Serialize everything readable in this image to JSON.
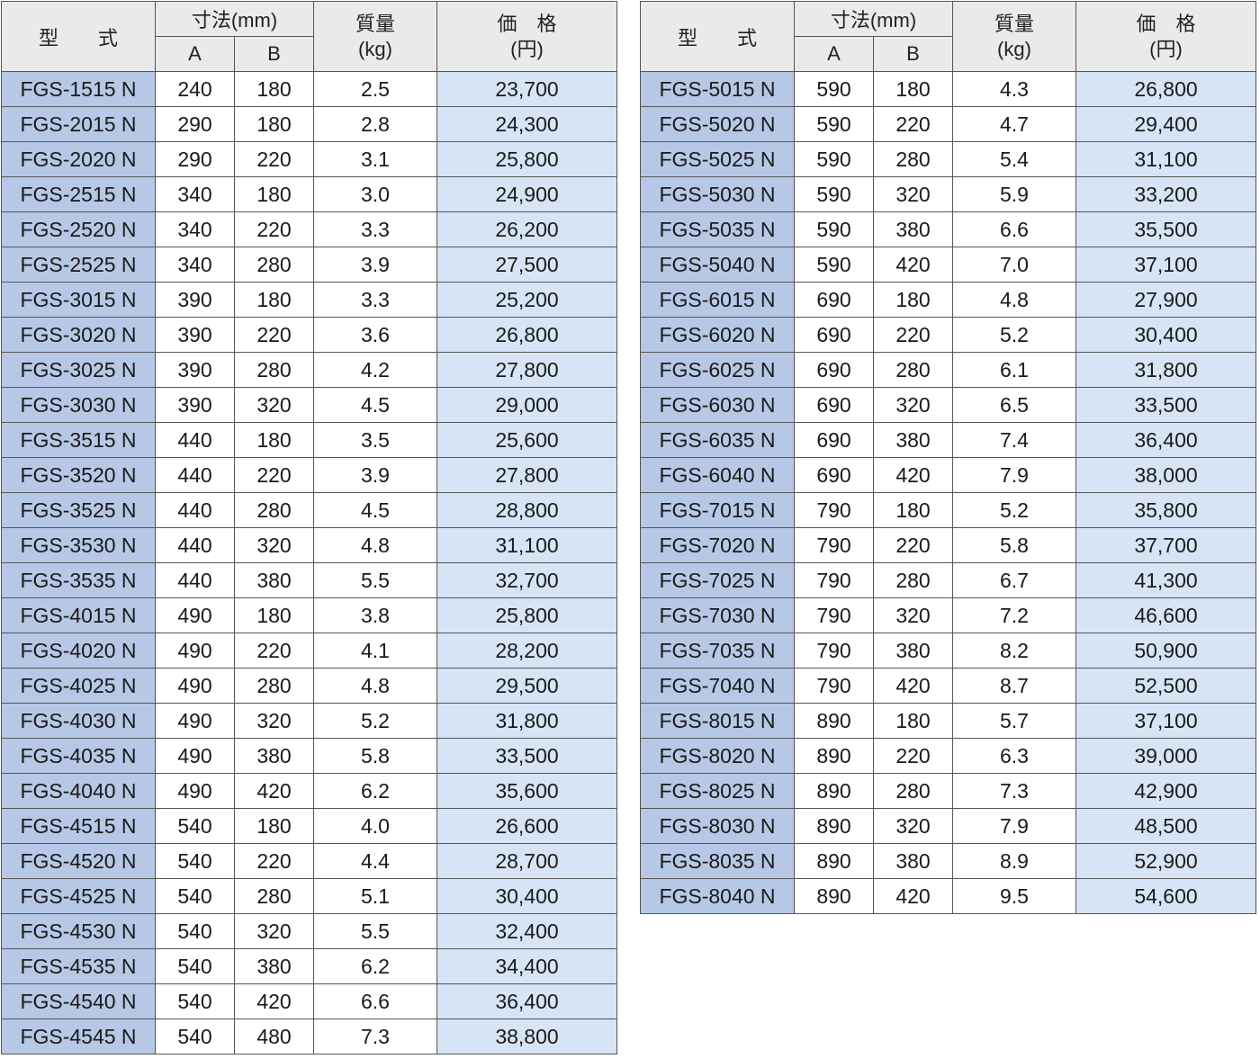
{
  "header": {
    "model": "型　　式",
    "dimensions": "寸法(mm)",
    "dim_a": "A",
    "dim_b": "B",
    "mass": "質量",
    "mass_unit": "(kg)",
    "price": "価　格",
    "price_unit": "(円)"
  },
  "left_rows": [
    {
      "model": "FGS-1515 N",
      "a": "240",
      "b": "180",
      "mass": "2.5",
      "price": "23,700"
    },
    {
      "model": "FGS-2015 N",
      "a": "290",
      "b": "180",
      "mass": "2.8",
      "price": "24,300"
    },
    {
      "model": "FGS-2020 N",
      "a": "290",
      "b": "220",
      "mass": "3.1",
      "price": "25,800"
    },
    {
      "model": "FGS-2515 N",
      "a": "340",
      "b": "180",
      "mass": "3.0",
      "price": "24,900"
    },
    {
      "model": "FGS-2520 N",
      "a": "340",
      "b": "220",
      "mass": "3.3",
      "price": "26,200"
    },
    {
      "model": "FGS-2525 N",
      "a": "340",
      "b": "280",
      "mass": "3.9",
      "price": "27,500"
    },
    {
      "model": "FGS-3015 N",
      "a": "390",
      "b": "180",
      "mass": "3.3",
      "price": "25,200"
    },
    {
      "model": "FGS-3020 N",
      "a": "390",
      "b": "220",
      "mass": "3.6",
      "price": "26,800"
    },
    {
      "model": "FGS-3025 N",
      "a": "390",
      "b": "280",
      "mass": "4.2",
      "price": "27,800"
    },
    {
      "model": "FGS-3030 N",
      "a": "390",
      "b": "320",
      "mass": "4.5",
      "price": "29,000"
    },
    {
      "model": "FGS-3515 N",
      "a": "440",
      "b": "180",
      "mass": "3.5",
      "price": "25,600"
    },
    {
      "model": "FGS-3520 N",
      "a": "440",
      "b": "220",
      "mass": "3.9",
      "price": "27,800"
    },
    {
      "model": "FGS-3525 N",
      "a": "440",
      "b": "280",
      "mass": "4.5",
      "price": "28,800"
    },
    {
      "model": "FGS-3530 N",
      "a": "440",
      "b": "320",
      "mass": "4.8",
      "price": "31,100"
    },
    {
      "model": "FGS-3535 N",
      "a": "440",
      "b": "380",
      "mass": "5.5",
      "price": "32,700"
    },
    {
      "model": "FGS-4015 N",
      "a": "490",
      "b": "180",
      "mass": "3.8",
      "price": "25,800"
    },
    {
      "model": "FGS-4020 N",
      "a": "490",
      "b": "220",
      "mass": "4.1",
      "price": "28,200"
    },
    {
      "model": "FGS-4025 N",
      "a": "490",
      "b": "280",
      "mass": "4.8",
      "price": "29,500"
    },
    {
      "model": "FGS-4030 N",
      "a": "490",
      "b": "320",
      "mass": "5.2",
      "price": "31,800"
    },
    {
      "model": "FGS-4035 N",
      "a": "490",
      "b": "380",
      "mass": "5.8",
      "price": "33,500"
    },
    {
      "model": "FGS-4040 N",
      "a": "490",
      "b": "420",
      "mass": "6.2",
      "price": "35,600"
    },
    {
      "model": "FGS-4515 N",
      "a": "540",
      "b": "180",
      "mass": "4.0",
      "price": "26,600"
    },
    {
      "model": "FGS-4520 N",
      "a": "540",
      "b": "220",
      "mass": "4.4",
      "price": "28,700"
    },
    {
      "model": "FGS-4525 N",
      "a": "540",
      "b": "280",
      "mass": "5.1",
      "price": "30,400"
    },
    {
      "model": "FGS-4530 N",
      "a": "540",
      "b": "320",
      "mass": "5.5",
      "price": "32,400"
    },
    {
      "model": "FGS-4535 N",
      "a": "540",
      "b": "380",
      "mass": "6.2",
      "price": "34,400"
    },
    {
      "model": "FGS-4540 N",
      "a": "540",
      "b": "420",
      "mass": "6.6",
      "price": "36,400"
    },
    {
      "model": "FGS-4545 N",
      "a": "540",
      "b": "480",
      "mass": "7.3",
      "price": "38,800"
    }
  ],
  "right_rows": [
    {
      "model": "FGS-5015 N",
      "a": "590",
      "b": "180",
      "mass": "4.3",
      "price": "26,800"
    },
    {
      "model": "FGS-5020 N",
      "a": "590",
      "b": "220",
      "mass": "4.7",
      "price": "29,400"
    },
    {
      "model": "FGS-5025 N",
      "a": "590",
      "b": "280",
      "mass": "5.4",
      "price": "31,100"
    },
    {
      "model": "FGS-5030 N",
      "a": "590",
      "b": "320",
      "mass": "5.9",
      "price": "33,200"
    },
    {
      "model": "FGS-5035 N",
      "a": "590",
      "b": "380",
      "mass": "6.6",
      "price": "35,500"
    },
    {
      "model": "FGS-5040 N",
      "a": "590",
      "b": "420",
      "mass": "7.0",
      "price": "37,100"
    },
    {
      "model": "FGS-6015 N",
      "a": "690",
      "b": "180",
      "mass": "4.8",
      "price": "27,900"
    },
    {
      "model": "FGS-6020 N",
      "a": "690",
      "b": "220",
      "mass": "5.2",
      "price": "30,400"
    },
    {
      "model": "FGS-6025 N",
      "a": "690",
      "b": "280",
      "mass": "6.1",
      "price": "31,800"
    },
    {
      "model": "FGS-6030 N",
      "a": "690",
      "b": "320",
      "mass": "6.5",
      "price": "33,500"
    },
    {
      "model": "FGS-6035 N",
      "a": "690",
      "b": "380",
      "mass": "7.4",
      "price": "36,400"
    },
    {
      "model": "FGS-6040 N",
      "a": "690",
      "b": "420",
      "mass": "7.9",
      "price": "38,000"
    },
    {
      "model": "FGS-7015 N",
      "a": "790",
      "b": "180",
      "mass": "5.2",
      "price": "35,800"
    },
    {
      "model": "FGS-7020 N",
      "a": "790",
      "b": "220",
      "mass": "5.8",
      "price": "37,700"
    },
    {
      "model": "FGS-7025 N",
      "a": "790",
      "b": "280",
      "mass": "6.7",
      "price": "41,300"
    },
    {
      "model": "FGS-7030 N",
      "a": "790",
      "b": "320",
      "mass": "7.2",
      "price": "46,600"
    },
    {
      "model": "FGS-7035 N",
      "a": "790",
      "b": "380",
      "mass": "8.2",
      "price": "50,900"
    },
    {
      "model": "FGS-7040 N",
      "a": "790",
      "b": "420",
      "mass": "8.7",
      "price": "52,500"
    },
    {
      "model": "FGS-8015 N",
      "a": "890",
      "b": "180",
      "mass": "5.7",
      "price": "37,100"
    },
    {
      "model": "FGS-8020 N",
      "a": "890",
      "b": "220",
      "mass": "6.3",
      "price": "39,000"
    },
    {
      "model": "FGS-8025 N",
      "a": "890",
      "b": "280",
      "mass": "7.3",
      "price": "42,900"
    },
    {
      "model": "FGS-8030 N",
      "a": "890",
      "b": "320",
      "mass": "7.9",
      "price": "48,500"
    },
    {
      "model": "FGS-8035 N",
      "a": "890",
      "b": "380",
      "mass": "8.9",
      "price": "52,900"
    },
    {
      "model": "FGS-8040 N",
      "a": "890",
      "b": "420",
      "mass": "9.5",
      "price": "54,600"
    }
  ],
  "colors": {
    "model_cell": "#b6c8e6",
    "price_cell": "#d6e4f5",
    "header_cell": "#eaeaea"
  }
}
